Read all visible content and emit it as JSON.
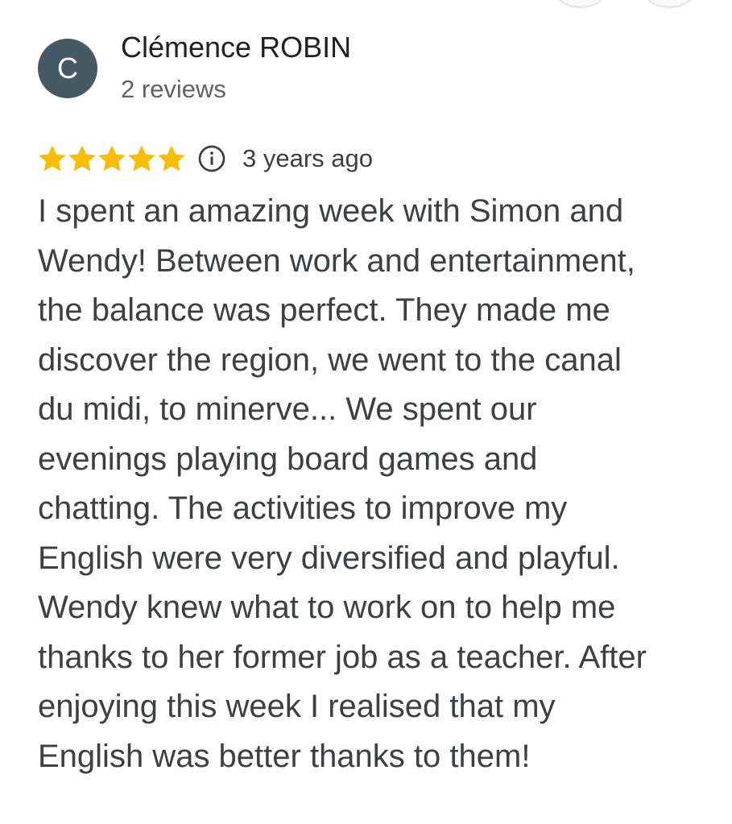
{
  "reviewer": {
    "initial": "C",
    "name": "Clémence ROBIN",
    "review_count": "2 reviews",
    "avatar_color": "#455a64"
  },
  "rating": {
    "stars": 5,
    "max_stars": 5,
    "star_color": "#fbbc04",
    "date": "3 years ago"
  },
  "review": {
    "lines": [
      "I spent an amazing week with Simon and",
      "Wendy! Between work and entertainment,",
      "the balance was perfect. They made me",
      "discover the region, we went to the canal",
      "du midi, to minerve... We spent our",
      "evenings playing board games and",
      "chatting. The activities to improve my",
      "English were very diversified and playful.",
      "Wendy knew what to work on to help me",
      "thanks to her former job as a teacher. After",
      "enjoying this week I realised that my",
      "English was better thanks to them!"
    ]
  }
}
